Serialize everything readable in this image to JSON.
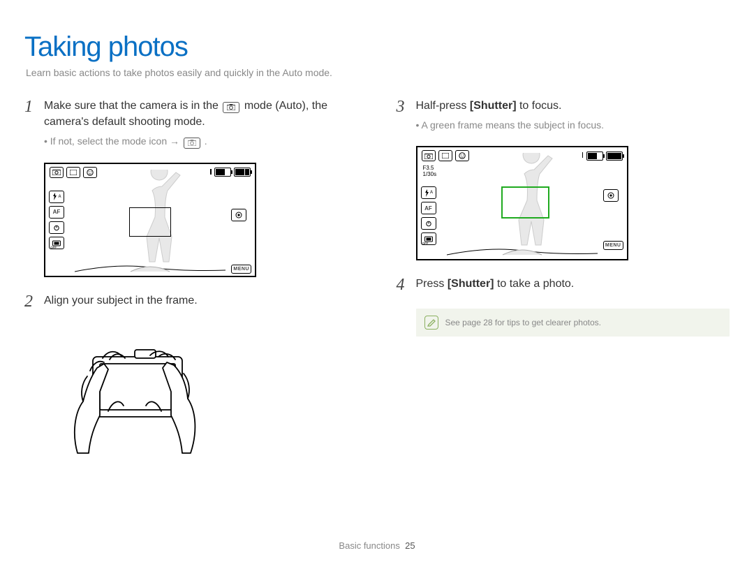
{
  "title": "Taking photos",
  "subtitle": "Learn basic actions to take photos easily and quickly in the Auto mode.",
  "left": {
    "step1": {
      "num": "1",
      "text_a": "Make sure that the camera is in the",
      "text_b": " mode (Auto), the camera's default shooting mode.",
      "bullet_a": "If not, select the mode icon → ",
      "bullet_b": "."
    },
    "step2": {
      "num": "2",
      "text": "Align your subject in the frame."
    }
  },
  "right": {
    "step3": {
      "num": "3",
      "text_a": "Half-press ",
      "shutter": "[Shutter]",
      "text_b": " to focus.",
      "bullet": "A green frame means the subject in focus."
    },
    "step4": {
      "num": "4",
      "text_a": "Press ",
      "shutter": "[Shutter]",
      "text_b": " to take a photo."
    }
  },
  "lcd": {
    "flash_auto": "A",
    "af": "AF",
    "off": "OFF",
    "menu": "MENU",
    "aperture": "F3.5",
    "shutter_speed": "1/30s"
  },
  "note": "See page 28 for tips to get clearer photos.",
  "footer": {
    "section": "Basic functions",
    "page": "25"
  }
}
